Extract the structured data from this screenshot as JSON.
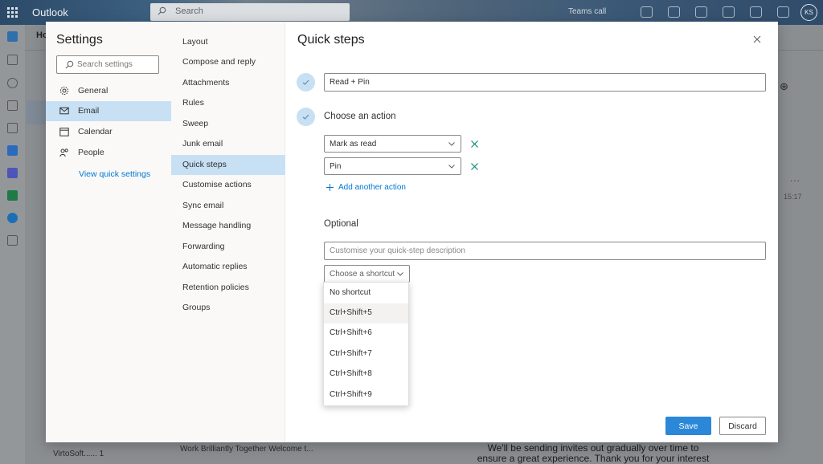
{
  "app": {
    "name": "Outlook",
    "search_placeholder": "Search",
    "teams_call": "Teams call",
    "avatar_initials": "KS",
    "home_tab": "Ho"
  },
  "background": {
    "time": "15:17",
    "more": "...",
    "bottom_sender": "VirtoSoft...... 1",
    "bottom_subject": "Work Brilliantly Together Welcome t...",
    "bottom_message": "We'll be sending invites out gradually over time to ensure a great experience. Thank you for your interest and your"
  },
  "settings": {
    "title": "Settings",
    "search_placeholder": "Search settings",
    "categories": [
      {
        "label": "General",
        "icon": "gear-icon"
      },
      {
        "label": "Email",
        "icon": "mail-icon"
      },
      {
        "label": "Calendar",
        "icon": "calendar-icon"
      },
      {
        "label": "People",
        "icon": "people-icon"
      }
    ],
    "view_quick_settings": "View quick settings",
    "email_subcategories": [
      "Layout",
      "Compose and reply",
      "Attachments",
      "Rules",
      "Sweep",
      "Junk email",
      "Quick steps",
      "Customise actions",
      "Sync email",
      "Message handling",
      "Forwarding",
      "Automatic replies",
      "Retention policies",
      "Groups"
    ]
  },
  "quick_steps": {
    "title": "Quick steps",
    "name_value": "Read + Pin",
    "choose_action_label": "Choose an action",
    "actions": [
      "Mark as read",
      "Pin"
    ],
    "add_another_action": "Add another action",
    "optional_label": "Optional",
    "description_placeholder": "Customise your quick-step description",
    "shortcut_placeholder": "Choose a shortcut",
    "shortcut_options": [
      "No shortcut",
      "Ctrl+Shift+5",
      "Ctrl+Shift+6",
      "Ctrl+Shift+7",
      "Ctrl+Shift+8",
      "Ctrl+Shift+9"
    ],
    "save_label": "Save",
    "discard_label": "Discard"
  },
  "colors": {
    "accent": "#0078d4",
    "selected_bg": "#c7e0f4",
    "save_bg": "#2b88d8"
  }
}
